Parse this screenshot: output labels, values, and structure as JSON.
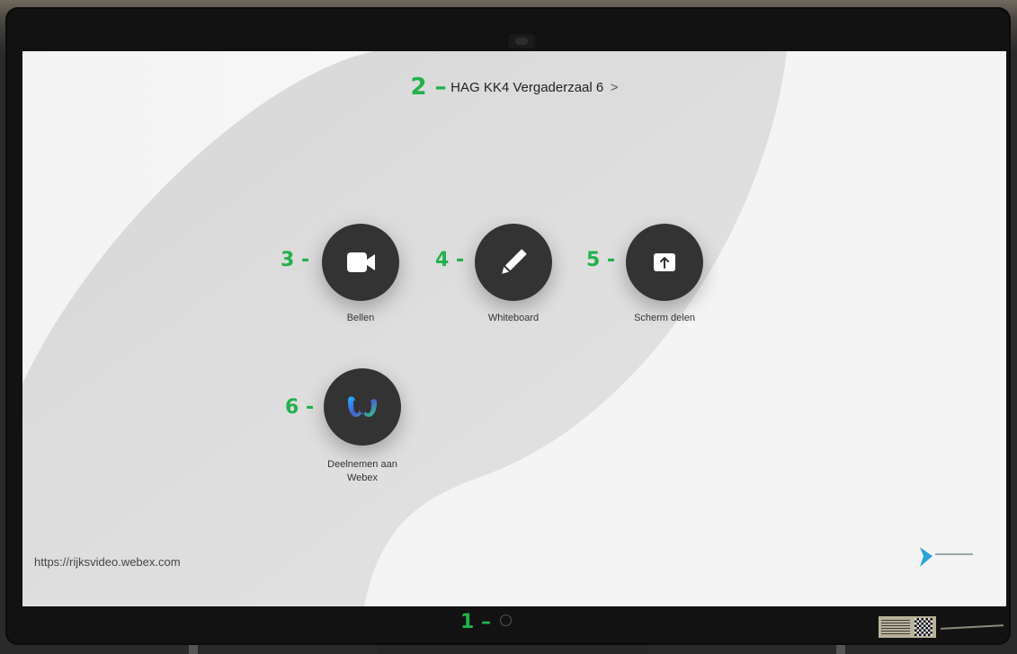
{
  "header": {
    "badge": "2 –",
    "room_name": "HAG KK4 Vergaderzaal 6",
    "chevron": ">"
  },
  "actions": [
    {
      "badge": "3 -",
      "label": "Bellen",
      "icon": "video-camera-icon"
    },
    {
      "badge": "4 -",
      "label": "Whiteboard",
      "icon": "pencil-icon"
    },
    {
      "badge": "5 -",
      "label": "Scherm delen",
      "icon": "share-screen-icon"
    },
    {
      "badge": "6 -",
      "label_line1": "Deelnemen aan",
      "label_line2": "Webex",
      "icon": "webex-logo-icon"
    }
  ],
  "footer": {
    "url": "https://rijksvideo.webex.com",
    "home_badge": "1 –"
  },
  "colors": {
    "badge": "#22b14c",
    "button": "#333333",
    "screen": "#eeeeee"
  }
}
